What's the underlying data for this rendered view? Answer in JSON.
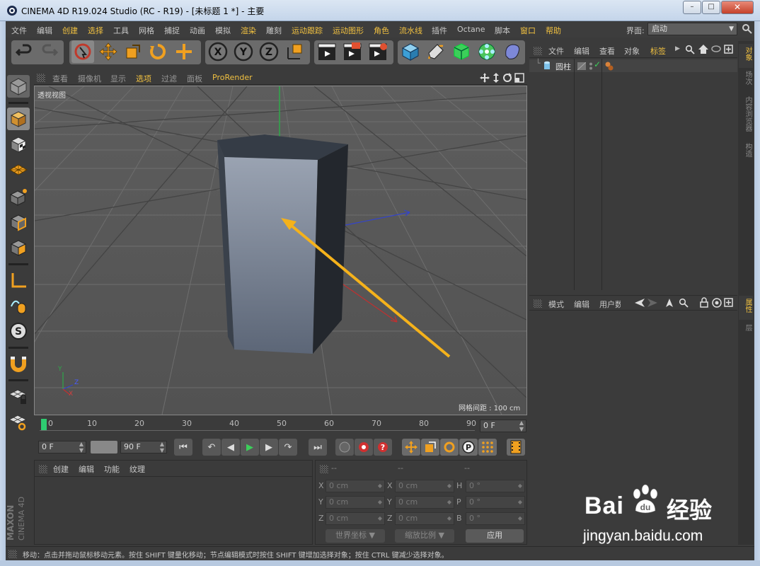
{
  "window": {
    "title": "CINEMA 4D R19.024 Studio (RC - R19) - [未标题 1 *] - 主要",
    "minimize": "–",
    "maximize": "□",
    "close": "✕"
  },
  "menubar": {
    "items": [
      {
        "label": "文件",
        "highlight": false
      },
      {
        "label": "编辑",
        "highlight": false
      },
      {
        "label": "创建",
        "highlight": true
      },
      {
        "label": "选择",
        "highlight": true
      },
      {
        "label": "工具",
        "highlight": false
      },
      {
        "label": "网格",
        "highlight": false
      },
      {
        "label": "捕捉",
        "highlight": false
      },
      {
        "label": "动画",
        "highlight": false
      },
      {
        "label": "模拟",
        "highlight": false
      },
      {
        "label": "渲染",
        "highlight": true
      },
      {
        "label": "雕刻",
        "highlight": false
      },
      {
        "label": "运动跟踪",
        "highlight": true
      },
      {
        "label": "运动图形",
        "highlight": true
      },
      {
        "label": "角色",
        "highlight": true
      },
      {
        "label": "流水线",
        "highlight": true
      },
      {
        "label": "插件",
        "highlight": false
      },
      {
        "label": "Octane",
        "highlight": false
      },
      {
        "label": "脚本",
        "highlight": false
      },
      {
        "label": "窗口",
        "highlight": true
      },
      {
        "label": "帮助",
        "highlight": true
      }
    ],
    "interface_label": "界面:",
    "interface_value": "启动"
  },
  "viewport": {
    "menu": [
      "查看",
      "摄像机",
      "显示",
      "选项",
      "过滤",
      "面板",
      "ProRender"
    ],
    "active_menu": "选项",
    "camera_label": "透视视图",
    "grid_spacing": "网格间距 : 100 cm",
    "axis_labels": {
      "y": "Y",
      "z": "Z",
      "x": "X"
    }
  },
  "timeline": {
    "ticks": [
      "0",
      "10",
      "20",
      "30",
      "40",
      "50",
      "60",
      "70",
      "80",
      "90"
    ],
    "current_frame": "0 F",
    "start_frame": "0 F",
    "end_frame": "90 F"
  },
  "material_panel": {
    "menu": [
      "创建",
      "编辑",
      "功能",
      "纹理"
    ]
  },
  "coord_panel": {
    "headers": [
      "--",
      "--",
      "--"
    ],
    "rows": [
      {
        "l1": "X",
        "v1": "0 cm",
        "l2": "X",
        "v2": "0 cm",
        "l3": "H",
        "v3": "0 °"
      },
      {
        "l1": "Y",
        "v1": "0 cm",
        "l2": "Y",
        "v2": "0 cm",
        "l3": "P",
        "v3": "0 °"
      },
      {
        "l1": "Z",
        "v1": "0 cm",
        "l2": "Z",
        "v2": "0 cm",
        "l3": "B",
        "v3": "0 °"
      }
    ],
    "world_coord": "世界坐标",
    "scale_mode": "缩放比例",
    "apply": "应用"
  },
  "object_manager": {
    "menu": [
      "文件",
      "编辑",
      "查看",
      "对象",
      "标签"
    ],
    "active_menu": "标签",
    "object_name": "圆柱"
  },
  "attribute_manager": {
    "menu": [
      "模式",
      "编辑",
      "用户数据"
    ]
  },
  "right_tabs": {
    "top": [
      "对象",
      "场次",
      "内容浏览器",
      "构造"
    ],
    "bottom": [
      "属性",
      "层"
    ]
  },
  "status_text": "移动：点击并拖动鼠标移动元素。按住 SHIFT 键量化移动；节点编辑模式时按住 SHIFT 键增加选择对象；按住 CTRL 键减少选择对象。",
  "logo": {
    "maker": "MAXON",
    "product": "CINEMA 4D"
  },
  "watermark": {
    "brand": "Bai",
    "brand2": "du",
    "cn": "经验",
    "url": "jingyan.baidu.com"
  },
  "colors": {
    "accent": "#f0c040",
    "viewport_bg": "#5a5a5a",
    "panel_bg": "#3b3b3b",
    "arrow": "#f5b21b"
  }
}
